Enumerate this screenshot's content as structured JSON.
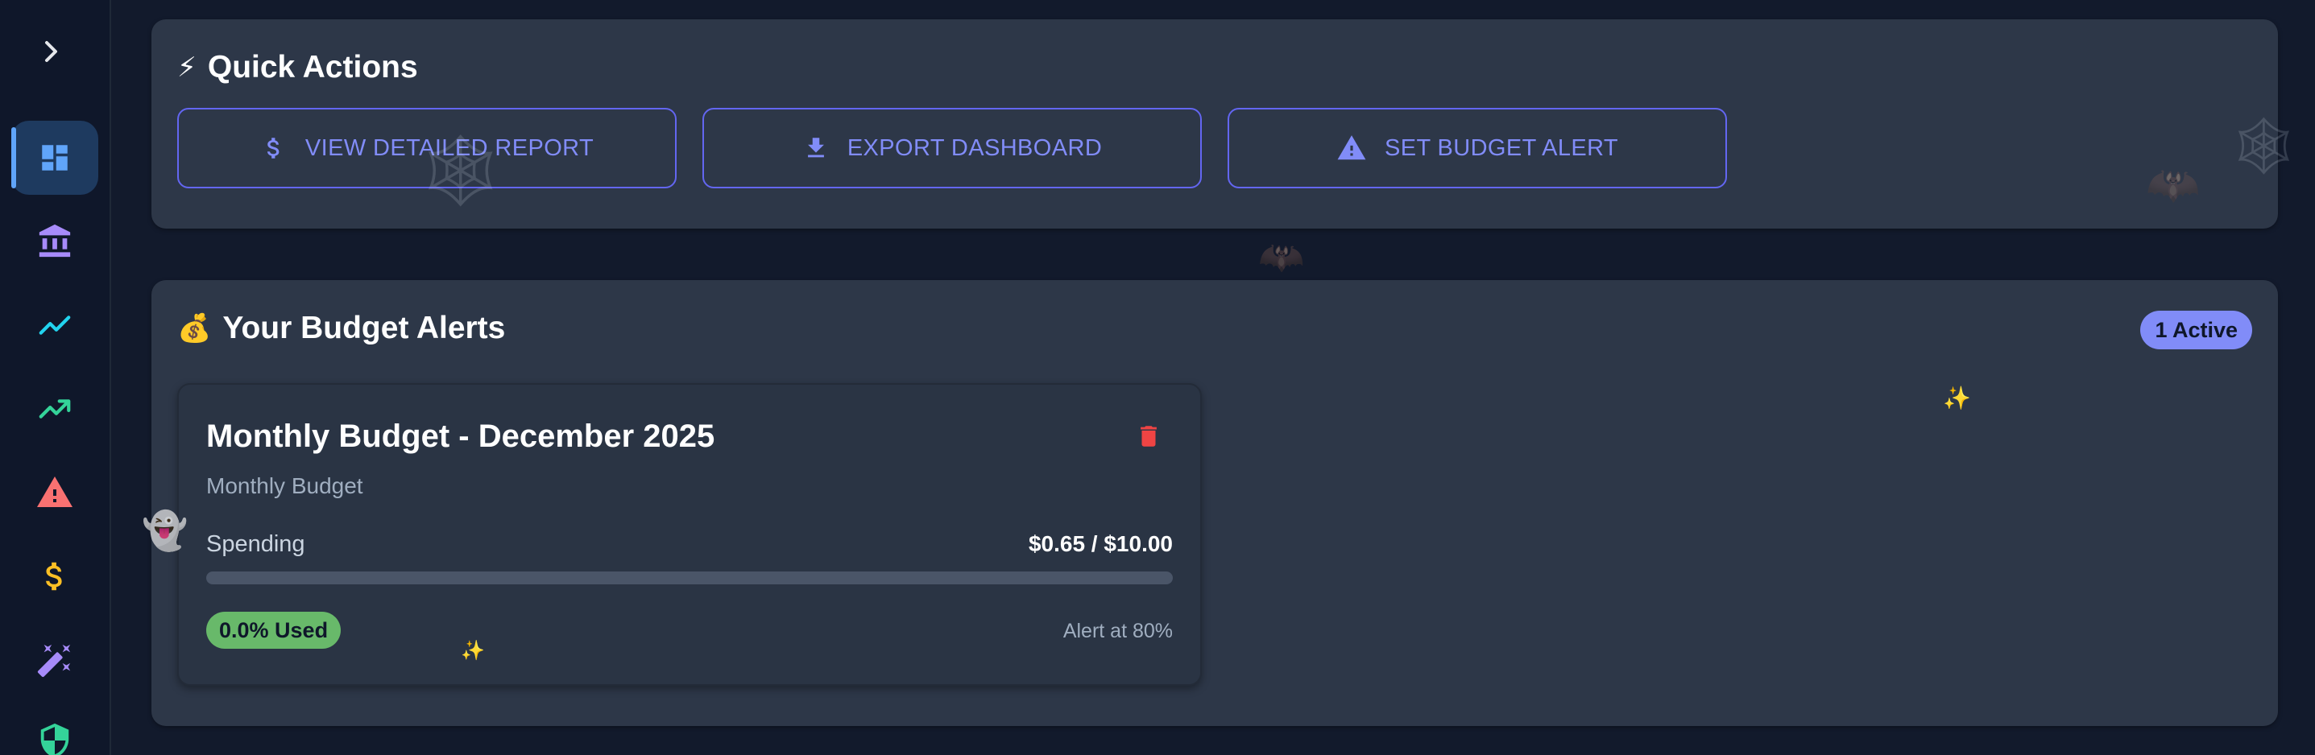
{
  "sidebar": {
    "toggle_icon": "chevron-right-icon",
    "items": [
      {
        "id": "dashboard",
        "icon": "dashboard-icon",
        "color": "#60a5fa",
        "active": true
      },
      {
        "id": "accounts",
        "icon": "bank-icon",
        "color": "#a78bfa",
        "active": false
      },
      {
        "id": "analytics",
        "icon": "line-chart-icon",
        "color": "#22d3ee",
        "active": false
      },
      {
        "id": "trends",
        "icon": "trending-up-icon",
        "color": "#34d399",
        "active": false
      },
      {
        "id": "alerts",
        "icon": "warning-icon",
        "color": "#f87171",
        "active": false
      },
      {
        "id": "budget",
        "icon": "dollar-icon",
        "color": "#fbbf24",
        "active": false
      },
      {
        "id": "ai",
        "icon": "magic-wand-icon",
        "color": "#a78bfa",
        "active": false
      },
      {
        "id": "security",
        "icon": "shield-icon",
        "color": "#34d399",
        "active": false
      }
    ]
  },
  "quick_actions": {
    "icon": "⚡",
    "title": "Quick Actions",
    "buttons": [
      {
        "label": "VIEW DETAILED REPORT",
        "icon": "dollar-icon"
      },
      {
        "label": "EXPORT DASHBOARD",
        "icon": "download-icon"
      },
      {
        "label": "SET BUDGET ALERT",
        "icon": "warning-icon"
      }
    ]
  },
  "budget_alerts": {
    "icon": "💰",
    "title": "Your Budget Alerts",
    "badge": "1 Active",
    "alerts": [
      {
        "title": "Monthly Budget - December 2025",
        "subtitle": "Monthly Budget",
        "spending_label": "Spending",
        "spending_value": "$0.65 / $10.00",
        "progress_fraction": 0.0,
        "used_label": "0.0% Used",
        "threshold_label": "Alert at 80%"
      }
    ]
  },
  "decorations": {
    "ghost": "👻",
    "sparkle": "✨",
    "spiderweb": "🕸",
    "bat": "🦇"
  },
  "colors": {
    "accent": "#818cf8",
    "danger": "#ef4444",
    "success": "#68b96a",
    "card_bg": "#2d3748",
    "page_bg": "#121a2c"
  }
}
